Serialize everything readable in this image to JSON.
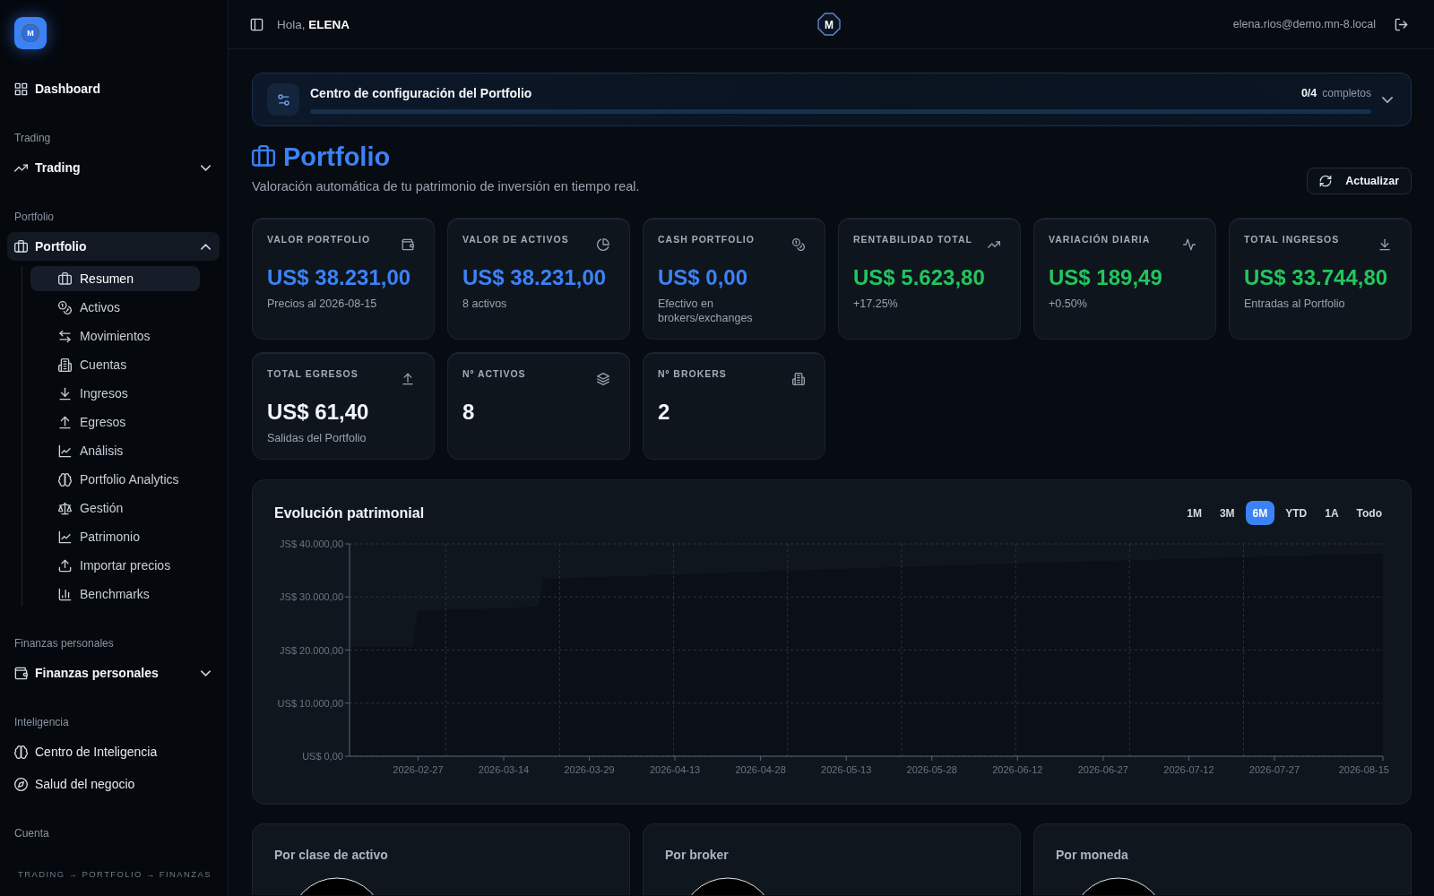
{
  "sidebar": {
    "logo": "M",
    "sections": [
      {
        "items": [
          {
            "label": "Dashboard",
            "selected": false
          }
        ]
      },
      {
        "heading": "Trading",
        "items": [
          {
            "label": "Trading",
            "selected": false,
            "expanded": false
          }
        ]
      },
      {
        "heading": "Portfolio",
        "items": [
          {
            "label": "Portfolio",
            "selected": true,
            "expanded": true,
            "children": [
              {
                "label": "Resumen",
                "selected": true
              },
              {
                "label": "Activos",
                "selected": false
              },
              {
                "label": "Movimientos",
                "selected": false
              },
              {
                "label": "Cuentas",
                "selected": false
              },
              {
                "label": "Ingresos",
                "selected": false
              },
              {
                "label": "Egresos",
                "selected": false
              },
              {
                "label": "Análisis",
                "selected": false
              },
              {
                "label": "Portfolio Analytics",
                "selected": false
              },
              {
                "label": "Gestión",
                "selected": false
              },
              {
                "label": "Patrimonio",
                "selected": false
              },
              {
                "label": "Importar precios",
                "selected": false
              },
              {
                "label": "Benchmarks",
                "selected": false
              }
            ]
          }
        ]
      },
      {
        "heading": "Finanzas personales",
        "items": [
          {
            "label": "Finanzas personales",
            "selected": false,
            "expanded": false
          }
        ]
      },
      {
        "heading": "Inteligencia",
        "items": [
          {
            "label": "Centro de Inteligencia",
            "selected": false
          },
          {
            "label": "Salud del negocio",
            "selected": false
          }
        ]
      },
      {
        "heading": "Cuenta"
      }
    ],
    "footer": "TRADING → PORTFOLIO → FINANZAS"
  },
  "topbar": {
    "greeting": "Hola, **ELENA**",
    "logo": "M",
    "email": "elena.rios@demo.mn-8.local"
  },
  "setup": {
    "title": "Centro de configuración del Portfolio",
    "count": "0/4",
    "count_label": "completos",
    "expanded": false
  },
  "header": {
    "title": "Portfolio",
    "subtitle": "Valoración automática de tu patrimonio de inversión en tiempo real.",
    "refresh_button": "Actualizar"
  },
  "stats": [
    {
      "label": "VALOR PORTFOLIO",
      "value": "US$ 38.231,00",
      "note": "Precios al 2026-08-15",
      "color": "#3b82f6"
    },
    {
      "label": "VALOR DE ACTIVOS",
      "value": "US$ 38.231,00",
      "note": "8 activos",
      "color": "#3b82f6"
    },
    {
      "label": "CASH PORTFOLIO",
      "value": "US$ 0,00",
      "note": "Efectivo en brokers/exchanges",
      "color": "#3b82f6"
    },
    {
      "label": "RENTABILIDAD TOTAL",
      "value": "US$ 5.623,80",
      "note": "+17.25%",
      "color": "#22c55e"
    },
    {
      "label": "VARIACIÓN DIARIA",
      "value": "US$ 189,49",
      "note": "+0.50%",
      "color": "#22c55e"
    },
    {
      "label": "TOTAL INGRESOS",
      "value": "US$ 33.744,80",
      "note": "Entradas al Portfolio",
      "color": "#22c55e"
    },
    {
      "label": "TOTAL EGRESOS",
      "value": "US$ 61,40",
      "note": "Salidas del Portfolio",
      "color": "#f1f5f9"
    },
    {
      "label": "Nº ACTIVOS",
      "value": "8",
      "color": "#f1f5f9"
    },
    {
      "label": "Nº BROKERS",
      "value": "2",
      "color": "#f1f5f9"
    }
  ],
  "chart": {
    "title": "Evolución patrimonial",
    "ranges": [
      {
        "label": "1M",
        "selected": false
      },
      {
        "label": "3M",
        "selected": false
      },
      {
        "label": "6M",
        "selected": true
      },
      {
        "label": "YTD",
        "selected": false
      },
      {
        "label": "1A",
        "selected": false
      },
      {
        "label": "Todo",
        "selected": false
      }
    ],
    "y_axis_labels": [
      "JS$ 40.000,00",
      "JS$ 30.000,00",
      "JS$ 20.000,00",
      "US$ 10.000,00",
      "US$ 0,00"
    ],
    "x_axis_labels": [
      "2026-02-27",
      "2026-03-14",
      "2026-03-29",
      "2026-04-13",
      "2026-04-28",
      "2026-05-13",
      "2026-05-28",
      "2026-06-12",
      "2026-06-27",
      "2026-07-12",
      "2026-07-27",
      "2026-08-15"
    ]
  },
  "breakdowns": [
    {
      "title": "Por clase de activo"
    },
    {
      "title": "Por broker"
    },
    {
      "title": "Por moneda"
    }
  ]
}
